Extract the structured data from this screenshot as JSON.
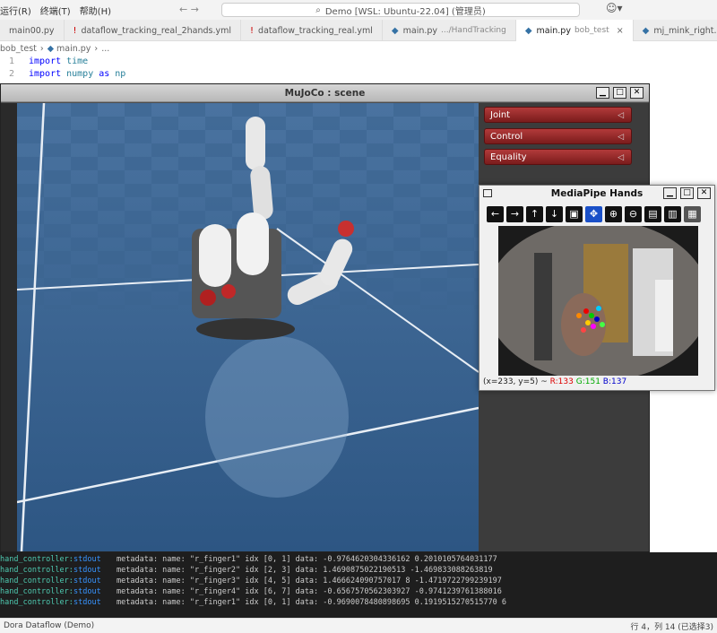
{
  "menu": {
    "items": [
      "运行(R)",
      "终端(T)",
      "帮助(H)"
    ]
  },
  "command_center": "Demo [WSL: Ubuntu-22.04] (管理员)",
  "tabs": [
    {
      "label": "main00.py",
      "sub": ""
    },
    {
      "label": "dataflow_tracking_real_2hands.yml",
      "sub": ""
    },
    {
      "label": "dataflow_tracking_real.yml",
      "sub": ""
    },
    {
      "label": "main.py",
      "sub": ".../HandTracking"
    },
    {
      "label": "main.py",
      "sub": "bob_test"
    },
    {
      "label": "mj_mink_right.py",
      "sub": ""
    }
  ],
  "breadcrumb": [
    "bob_test",
    "main.py",
    "..."
  ],
  "code": [
    {
      "num": "1",
      "keyword": "import",
      "module": "time",
      "as": "",
      "alias": ""
    },
    {
      "num": "2",
      "keyword": "import",
      "module": "numpy",
      "as": "as",
      "alias": "np"
    }
  ],
  "mujoco": {
    "title": "MuJoCo : scene",
    "buttons": [
      "Joint",
      "Control",
      "Equality"
    ]
  },
  "mediapipe": {
    "title": "MediaPipe Hands",
    "status_pos": "(x=233, y=5) ~",
    "status_r": "R:133",
    "status_g": "G:151",
    "status_b": "B:137"
  },
  "terminal": {
    "lines": [
      {
        "src": "hand_controller:",
        "stream": "stdout",
        "msg": "metadata: name: \"r_finger1\" idx [0, 1] data: -0.9764620304336162 0.2010105764031177"
      },
      {
        "src": "hand_controller:",
        "stream": "stdout",
        "msg": "metadata: name: \"r_finger2\" idx [2, 3] data: 1.4690875022190513 -1.469833088263819"
      },
      {
        "src": "hand_controller:",
        "stream": "stdout",
        "msg": "metadata: name: \"r_finger3\" idx [4, 5] data: 1.466624090757017 8 -1.4719722799239197"
      },
      {
        "src": "hand_controller:",
        "stream": "stdout",
        "msg": "metadata: name: \"r_finger4\" idx [6, 7] data: -0.6567570562303927 -0.9741239761388016"
      },
      {
        "src": "hand_controller:",
        "stream": "stdout",
        "msg": "metadata: name: \"r_finger1\" idx [0, 1] data: -0.9690078480898695 0.1919515270515770 6"
      }
    ]
  },
  "statusbar": {
    "left": "Dora Dataflow (Demo)",
    "right": "行 4，列 14 (已选择3)"
  }
}
